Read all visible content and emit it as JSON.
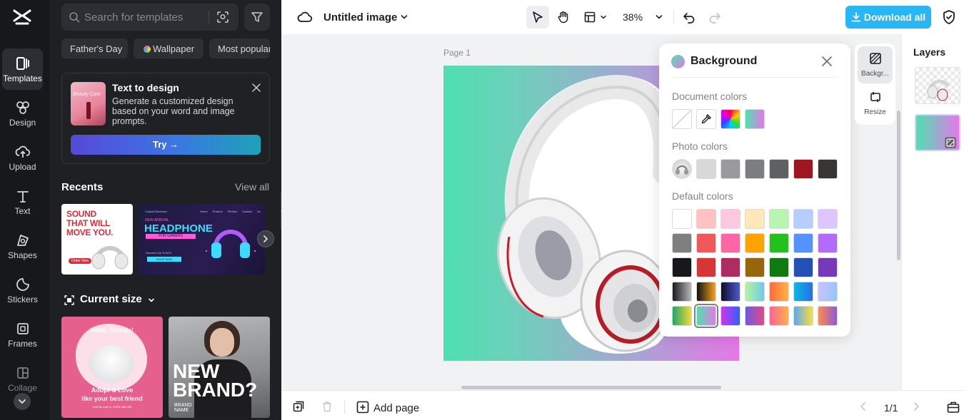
{
  "rail": {
    "items": [
      {
        "label": "Templates"
      },
      {
        "label": "Design"
      },
      {
        "label": "Upload"
      },
      {
        "label": "Text"
      },
      {
        "label": "Shapes"
      },
      {
        "label": "Stickers"
      },
      {
        "label": "Frames"
      },
      {
        "label": "Collage"
      }
    ]
  },
  "panel": {
    "search_placeholder": "Search for templates",
    "chips": [
      "Father's Day",
      "Wallpaper",
      "Most popular"
    ],
    "text_to_design": {
      "title": "Text to design",
      "description": "Generate a customized design based on your word and image prompts.",
      "try_label": "Try →",
      "thumb_text": "Beauty Care"
    },
    "recents_title": "Recents",
    "view_all": "View all",
    "recent1": {
      "headline": "SOUND THAT WILL MOVE YOU.",
      "cta": "Order Now"
    },
    "recent2": {
      "brand": "Crystal Electronic",
      "nav": [
        "Home",
        "Product",
        "Review",
        "Contact Us"
      ],
      "kicker": "NEW ARRIVAL",
      "headline": "HEADPHONE",
      "tag": "FOR GAMERS",
      "discount": "Discount Up To 50%",
      "cta": "SHOP NOW"
    },
    "current_size_title": "Current size",
    "card1": {
      "line1": "Hello, friends!",
      "line2": "Adopt & Love",
      "line3": "like your best friend",
      "line4": "Call me now to +0123-456-789"
    },
    "card2": {
      "line1": "NEW",
      "line2": "BRAND?",
      "small": "BRAND NAME"
    }
  },
  "topbar": {
    "title": "Untitled image",
    "zoom": "38%",
    "download": "Download all"
  },
  "canvas": {
    "page_label": "Page 1",
    "gradient": [
      "#4fe0b0",
      "#e777e8"
    ]
  },
  "background_popover": {
    "title": "Background",
    "document_colors_label": "Document colors",
    "photo_colors_label": "Photo colors",
    "default_colors_label": "Default colors",
    "photo_colors": [
      "#d7d8d9",
      "#9b999b",
      "#7c7f82",
      "#5f6061",
      "#9e1620",
      "#3a3535"
    ],
    "default_rows": [
      [
        "#ffffff",
        "#ffc1c1",
        "#ffc7e0",
        "#ffe8b8",
        "#b7f5b0",
        "#b7cdfd",
        "#ddc5ff"
      ],
      [
        "#7f7f7f",
        "#f0595a",
        "#fc65a6",
        "#ffa300",
        "#22c11c",
        "#5293fd",
        "#b36bfe"
      ],
      [
        "#17181b",
        "#d63636",
        "#ae2b63",
        "#986608",
        "#0f7a0f",
        "#2451b5",
        "#7738b9"
      ]
    ],
    "gradient_rows": [
      [
        "linear-gradient(90deg,#1a1b1f,#b8b8b8)",
        "linear-gradient(90deg,#111,#f9a21b)",
        "linear-gradient(90deg,#0d0d2b,#4c5bd4)",
        "linear-gradient(90deg,#b4f59f,#70c9ec)",
        "linear-gradient(90deg,#ff6a3d,#ffb346)",
        "linear-gradient(90deg,#0ab9e5,#2c6de0)",
        "linear-gradient(90deg,#c9c2fb,#94c8fa)"
      ],
      [
        "linear-gradient(90deg,#1fa664,#f7d83a)",
        "linear-gradient(90deg,#4fe0b0,#e777e8)",
        "linear-gradient(90deg,#d234f2,#2d63f7)",
        "linear-gradient(90deg,#6c5be0,#e64786)",
        "linear-gradient(90deg,#fc6196,#ffb347)",
        "linear-gradient(90deg,#5fa7ef,#fbde3a)",
        "linear-gradient(90deg,#ff8a4a,#8b5bd8)"
      ]
    ],
    "selected_gradient_index": 1
  },
  "side_tools": [
    {
      "label": "Backgr..."
    },
    {
      "label": "Resize"
    }
  ],
  "layers": {
    "title": "Layers"
  },
  "bottombar": {
    "add_page": "Add page",
    "pager": "1/1"
  }
}
